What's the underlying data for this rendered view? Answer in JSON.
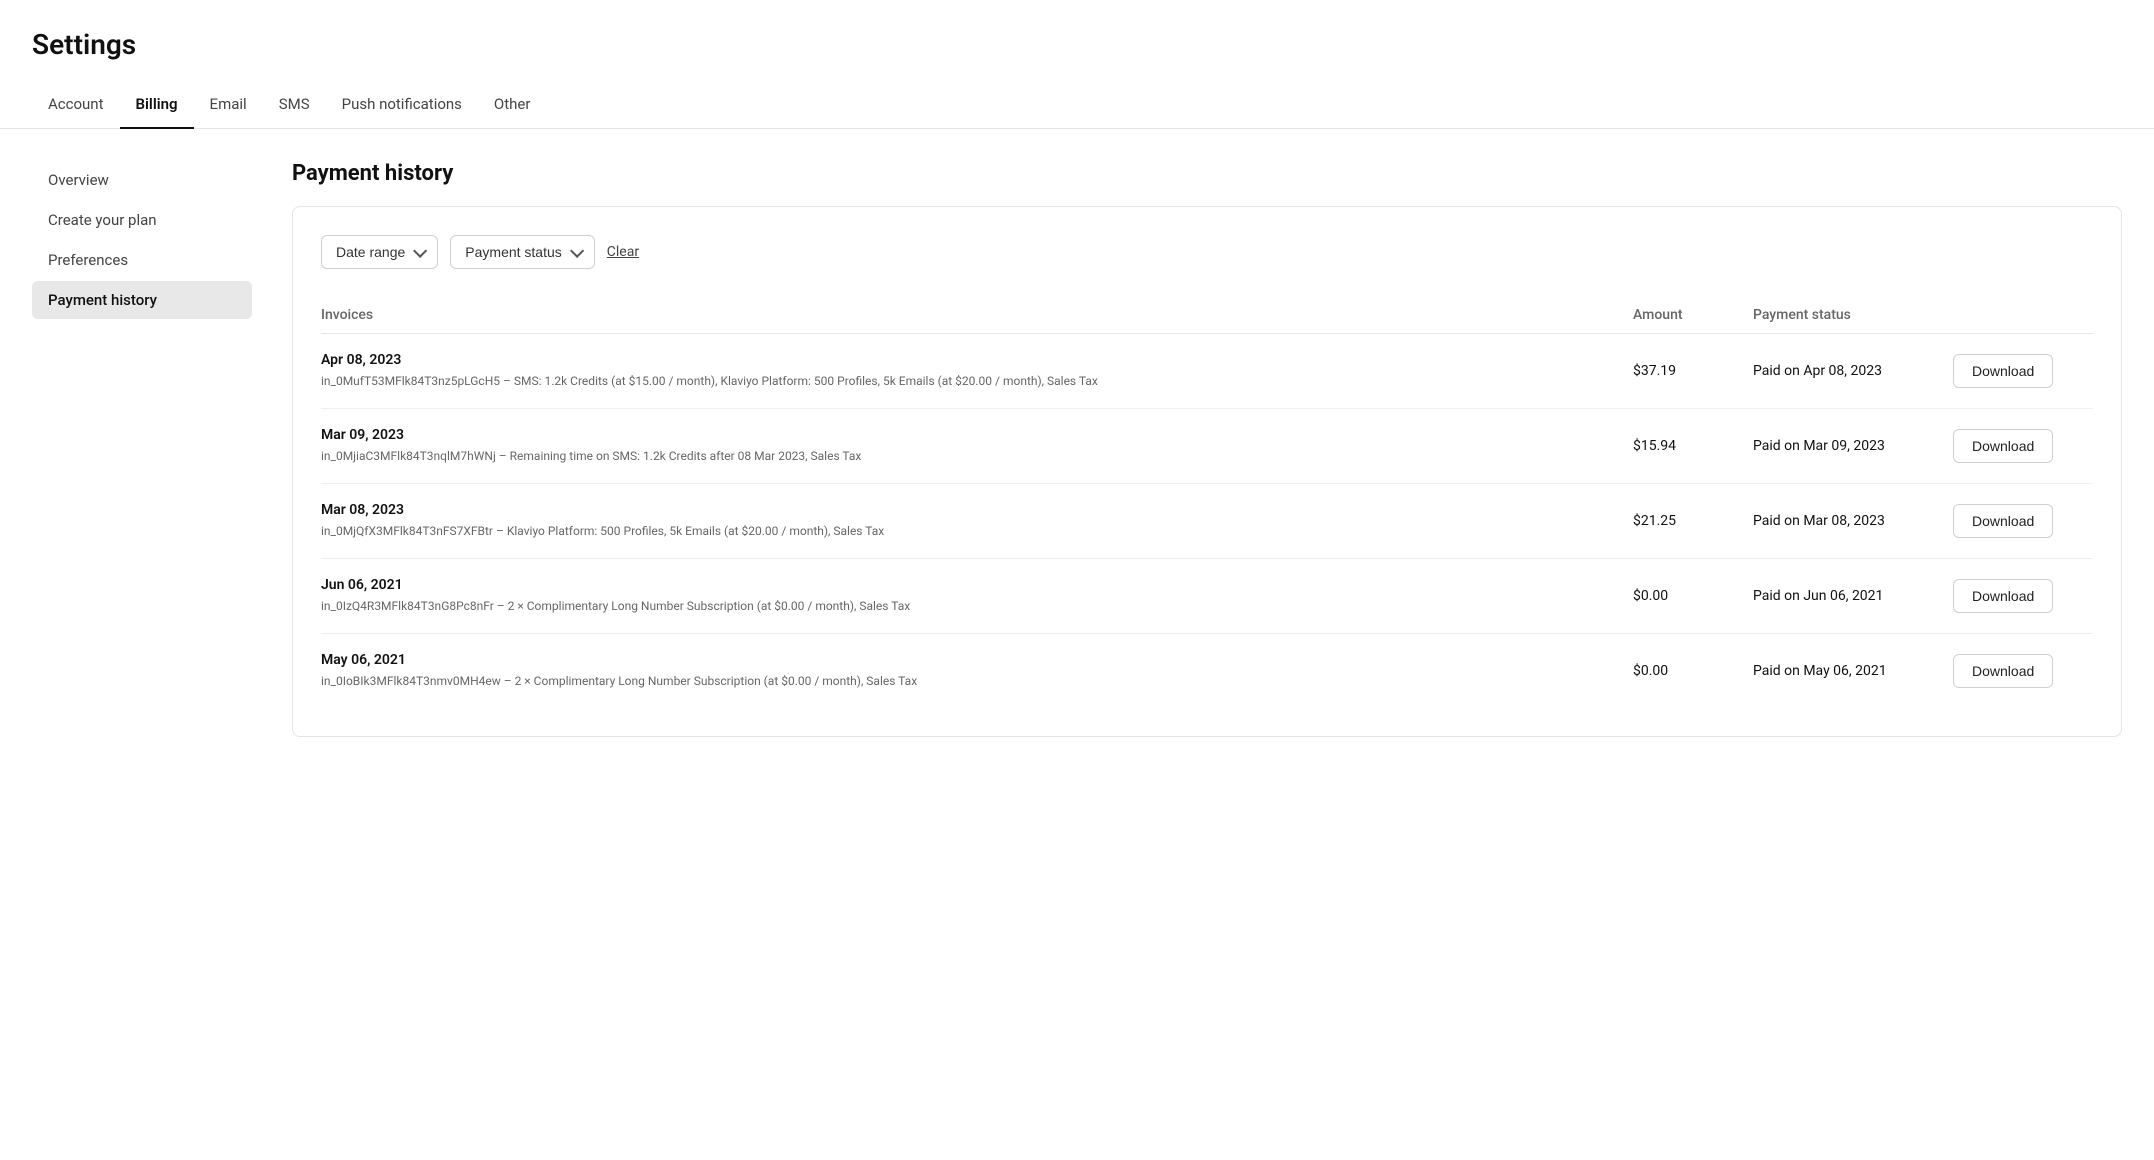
{
  "page": {
    "title": "Settings"
  },
  "top_nav": {
    "items": [
      {
        "id": "account",
        "label": "Account",
        "active": false
      },
      {
        "id": "billing",
        "label": "Billing",
        "active": true
      },
      {
        "id": "email",
        "label": "Email",
        "active": false
      },
      {
        "id": "sms",
        "label": "SMS",
        "active": false
      },
      {
        "id": "push-notifications",
        "label": "Push notifications",
        "active": false
      },
      {
        "id": "other",
        "label": "Other",
        "active": false
      }
    ]
  },
  "sidebar": {
    "items": [
      {
        "id": "overview",
        "label": "Overview",
        "active": false
      },
      {
        "id": "create-your-plan",
        "label": "Create your plan",
        "active": false
      },
      {
        "id": "preferences",
        "label": "Preferences",
        "active": false
      },
      {
        "id": "payment-history",
        "label": "Payment history",
        "active": true
      }
    ]
  },
  "main": {
    "title": "Payment history",
    "filters": {
      "date_range_label": "Date range",
      "payment_status_label": "Payment status",
      "clear_label": "Clear"
    },
    "table": {
      "headers": {
        "invoices": "Invoices",
        "amount": "Amount",
        "payment_status": "Payment status"
      },
      "rows": [
        {
          "date": "Apr 08, 2023",
          "invoice_id": "in_0MufT53MFlk84T3nz5pLGcH5 – SMS: 1.2k Credits (at $15.00 / month), Klaviyo Platform: 500 Profiles, 5k Emails (at $20.00 / month), Sales Tax",
          "amount": "$37.19",
          "payment_status": "Paid on Apr 08, 2023",
          "download_label": "Download"
        },
        {
          "date": "Mar 09, 2023",
          "invoice_id": "in_0MjiaC3MFlk84T3nqlM7hWNj – Remaining time on SMS: 1.2k Credits after 08 Mar 2023, Sales Tax",
          "amount": "$15.94",
          "payment_status": "Paid on Mar 09, 2023",
          "download_label": "Download"
        },
        {
          "date": "Mar 08, 2023",
          "invoice_id": "in_0MjQfX3MFlk84T3nFS7XFBtr – Klaviyo Platform: 500 Profiles, 5k Emails (at $20.00 / month), Sales Tax",
          "amount": "$21.25",
          "payment_status": "Paid on Mar 08, 2023",
          "download_label": "Download"
        },
        {
          "date": "Jun 06, 2021",
          "invoice_id": "in_0IzQ4R3MFlk84T3nG8Pc8nFr – 2 × Complimentary Long Number Subscription (at $0.00 / month), Sales Tax",
          "amount": "$0.00",
          "payment_status": "Paid on Jun 06, 2021",
          "download_label": "Download"
        },
        {
          "date": "May 06, 2021",
          "invoice_id": "in_0IoBIk3MFlk84T3nmv0MH4ew – 2 × Complimentary Long Number Subscription (at $0.00 / month), Sales Tax",
          "amount": "$0.00",
          "payment_status": "Paid on May 06, 2021",
          "download_label": "Download"
        }
      ]
    }
  }
}
